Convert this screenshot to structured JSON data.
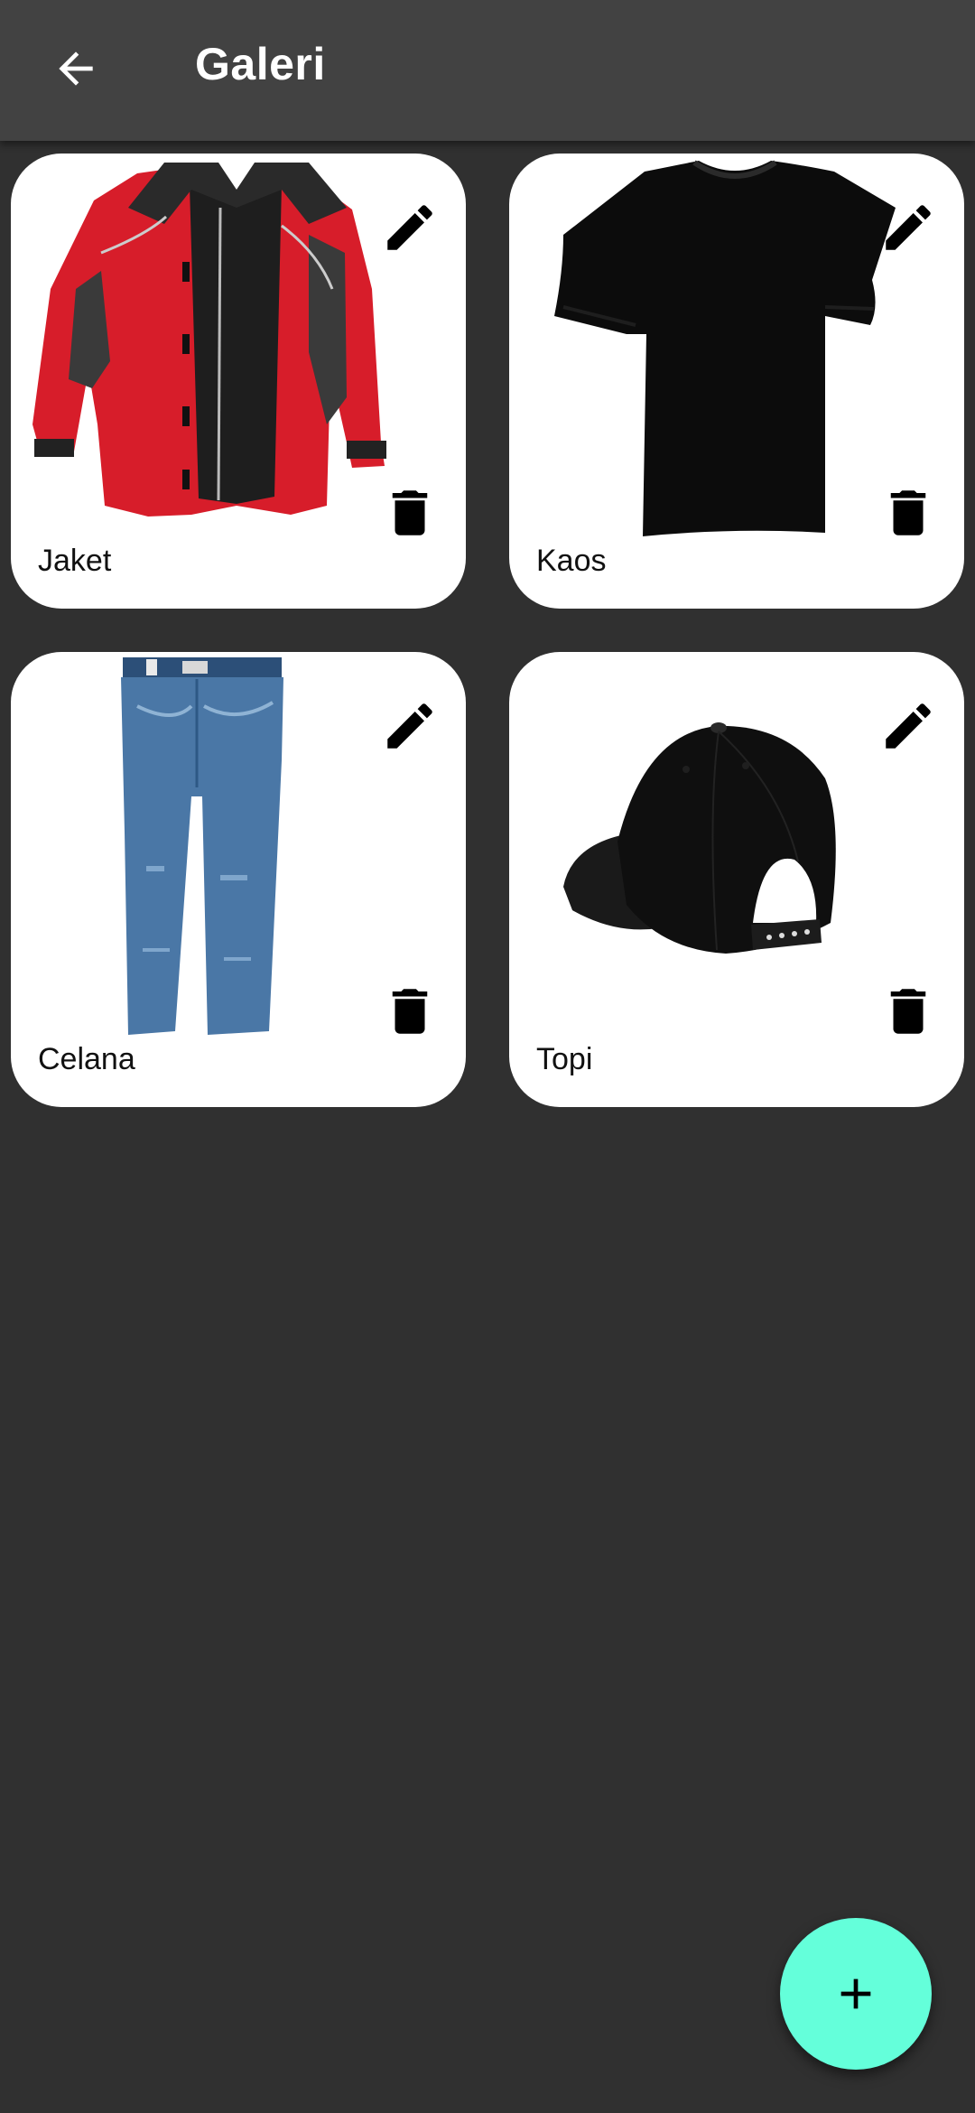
{
  "app_bar": {
    "title": "Galeri",
    "back_icon": "arrow-back-icon"
  },
  "gallery": {
    "items": [
      {
        "label": "Jaket",
        "image": "red-jacket-photo",
        "edit_icon": "pencil-icon",
        "delete_icon": "trash-icon"
      },
      {
        "label": "Kaos",
        "image": "black-tshirt-photo",
        "edit_icon": "pencil-icon",
        "delete_icon": "trash-icon"
      },
      {
        "label": "Celana",
        "image": "blue-jeans-photo",
        "edit_icon": "pencil-icon",
        "delete_icon": "trash-icon"
      },
      {
        "label": "Topi",
        "image": "black-cap-photo",
        "edit_icon": "pencil-icon",
        "delete_icon": "trash-icon"
      }
    ]
  },
  "fab": {
    "icon": "plus-icon"
  },
  "colors": {
    "background": "#303030",
    "app_bar": "#424242",
    "card": "#ffffff",
    "fab": "#64ffda"
  }
}
